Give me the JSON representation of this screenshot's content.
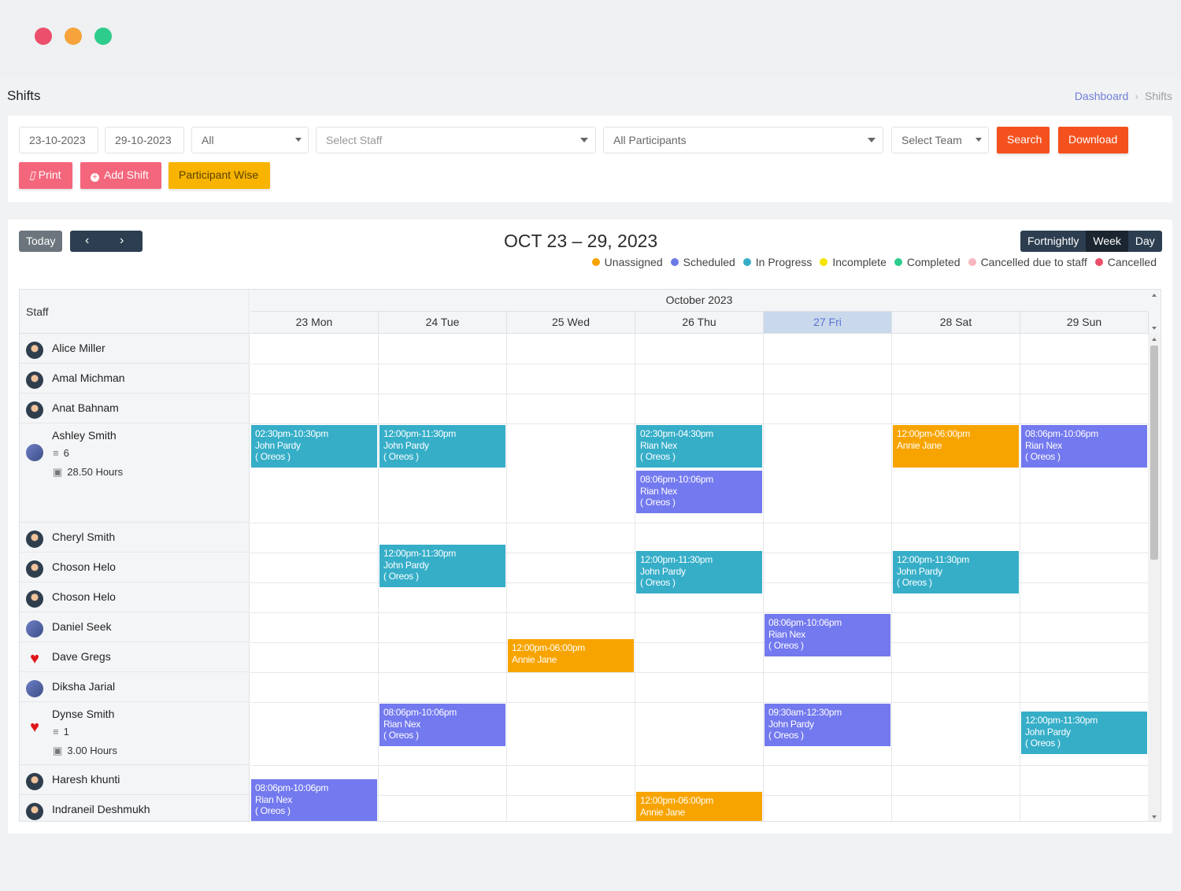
{
  "page": {
    "title": "Shifts",
    "breadcrumb": [
      "Dashboard",
      "Shifts"
    ]
  },
  "filters": {
    "start_date": "23-10-2023",
    "end_date": "29-10-2023",
    "status_select": "All",
    "staff_placeholder": "Select Staff",
    "participants_select": "All Participants",
    "team_placeholder": "Select Team",
    "search_label": "Search",
    "download_label": "Download",
    "print_label": "Print",
    "add_shift_label": "Add Shift",
    "participant_wise_label": "Participant Wise"
  },
  "colors": {
    "search_button": "#f4511e",
    "download_button": "#f4511e",
    "print_button": "#f4667c",
    "add_shift_button": "#f4667c",
    "participant_wise_button": "#f8b400",
    "scheduled": "#7379ee",
    "in_progress": "#36aec8",
    "unassigned": "#f8a400"
  },
  "calendar": {
    "today_label": "Today",
    "prev_icon": "chevron-left-icon",
    "next_icon": "chevron-right-icon",
    "title": "OCT 23 – 29, 2023",
    "views": [
      "Fortnightly",
      "Week",
      "Day"
    ],
    "active_view": "Week",
    "legend": [
      {
        "label": "Unassigned",
        "color": "#f8a400"
      },
      {
        "label": "Scheduled",
        "color": "#6c7ae8"
      },
      {
        "label": "In Progress",
        "color": "#36aec8"
      },
      {
        "label": "Incomplete",
        "color": "#f5e400"
      },
      {
        "label": "Completed",
        "color": "#2ecc8c"
      },
      {
        "label": "Cancelled due to staff",
        "color": "#f7b6c0"
      },
      {
        "label": "Cancelled",
        "color": "#ec4f6b"
      }
    ],
    "staff_header": "Staff",
    "month_label": "October 2023",
    "days": [
      "23 Mon",
      "24 Tue",
      "25 Wed",
      "26 Thu",
      "27 Fri",
      "28 Sat",
      "29 Sun"
    ],
    "current_day": "27 Fri"
  },
  "staff": [
    {
      "name": "Alice Miller",
      "avatar": "person"
    },
    {
      "name": "Amal Michman",
      "avatar": "person"
    },
    {
      "name": "Anat Bahnam",
      "avatar": "person"
    },
    {
      "name": "Ashley Smith",
      "avatar": "photo",
      "count": "6",
      "hours": "28.50 Hours"
    },
    {
      "name": "Cheryl Smith",
      "avatar": "person"
    },
    {
      "name": "Choson Helo",
      "avatar": "person"
    },
    {
      "name": "Choson Helo",
      "avatar": "person"
    },
    {
      "name": "Daniel Seek",
      "avatar": "photo"
    },
    {
      "name": "Dave Gregs",
      "avatar": "heart"
    },
    {
      "name": "Diksha Jarial",
      "avatar": "photo"
    },
    {
      "name": "Dynse Smith",
      "avatar": "heart",
      "count": "1",
      "hours": "3.00 Hours"
    },
    {
      "name": "Haresh khunti",
      "avatar": "person"
    },
    {
      "name": "Indraneil Deshmukh",
      "avatar": "person"
    }
  ],
  "events": [
    {
      "staff": "Ashley Smith",
      "day": "23 Mon",
      "time": "02:30pm-10:30pm",
      "person": "John Pardy",
      "org": "( Oreos )",
      "status": "In Progress"
    },
    {
      "staff": "Ashley Smith",
      "day": "24 Tue",
      "time": "12:00pm-11:30pm",
      "person": "John Pardy",
      "org": "( Oreos )",
      "status": "In Progress"
    },
    {
      "staff": "Ashley Smith",
      "day": "26 Thu",
      "time": "02:30pm-04:30pm",
      "person": "Rian Nex",
      "org": "( Oreos )",
      "status": "In Progress"
    },
    {
      "staff": "Ashley Smith",
      "day": "26 Thu",
      "time": "08:06pm-10:06pm",
      "person": "Rian Nex",
      "org": "( Oreos )",
      "status": "Scheduled"
    },
    {
      "staff": "Ashley Smith",
      "day": "28 Sat",
      "time": "12:00pm-06:00pm",
      "person": "Annie Jane",
      "org": "",
      "status": "Unassigned"
    },
    {
      "staff": "Ashley Smith",
      "day": "29 Sun",
      "time": "08:06pm-10:06pm",
      "person": "Rian Nex",
      "org": "( Oreos )",
      "status": "Scheduled"
    },
    {
      "staff": "Choson Helo",
      "day": "24 Tue",
      "time": "12:00pm-11:30pm",
      "person": "John Pardy",
      "org": "( Oreos )",
      "status": "In Progress"
    },
    {
      "staff": "Choson Helo",
      "day": "26 Thu",
      "time": "12:00pm-11:30pm",
      "person": "John Pardy",
      "org": "( Oreos )",
      "status": "In Progress"
    },
    {
      "staff": "Choson Helo",
      "day": "28 Sat",
      "time": "12:00pm-11:30pm",
      "person": "John Pardy",
      "org": "( Oreos )",
      "status": "In Progress"
    },
    {
      "staff": "Daniel Seek",
      "day": "27 Fri",
      "time": "08:06pm-10:06pm",
      "person": "Rian Nex",
      "org": "( Oreos )",
      "status": "Scheduled"
    },
    {
      "staff": "Dave Gregs",
      "day": "25 Wed",
      "time": "12:00pm-06:00pm",
      "person": "Annie Jane",
      "org": "",
      "status": "Unassigned"
    },
    {
      "staff": "Dynse Smith",
      "day": "24 Tue",
      "time": "08:06pm-10:06pm",
      "person": "Rian Nex",
      "org": "( Oreos )",
      "status": "Scheduled"
    },
    {
      "staff": "Dynse Smith",
      "day": "27 Fri",
      "time": "09:30am-12:30pm",
      "person": "John Pardy",
      "org": "( Oreos )",
      "status": "Scheduled"
    },
    {
      "staff": "Dynse Smith",
      "day": "29 Sun",
      "time": "12:00pm-11:30pm",
      "person": "John Pardy",
      "org": "( Oreos )",
      "status": "In Progress"
    },
    {
      "staff": "Haresh khunti",
      "day": "23 Mon",
      "time": "08:06pm-10:06pm",
      "person": "Rian Nex",
      "org": "( Oreos )",
      "status": "Scheduled"
    },
    {
      "staff": "Indraneil Deshmukh",
      "day": "26 Thu",
      "time": "12:00pm-06:00pm",
      "person": "Annie Jane",
      "org": "",
      "status": "Unassigned"
    }
  ]
}
